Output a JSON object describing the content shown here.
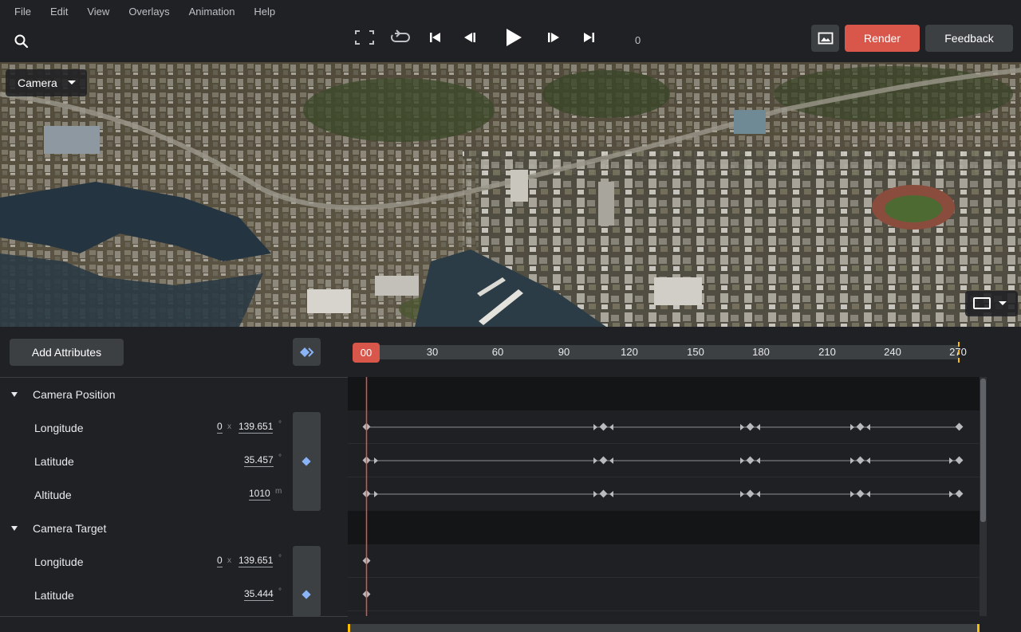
{
  "menu": [
    "File",
    "Edit",
    "View",
    "Overlays",
    "Animation",
    "Help"
  ],
  "toolbar": {
    "frame": "0",
    "render_label": "Render",
    "feedback_label": "Feedback"
  },
  "viewport": {
    "camera_select": "Camera"
  },
  "panel": {
    "add_attributes_label": "Add Attributes",
    "playhead_label": "00",
    "ruler_ticks": [
      "30",
      "60",
      "90",
      "120",
      "150",
      "180",
      "210",
      "240",
      "270"
    ],
    "groups": [
      {
        "name": "Camera Position",
        "attributes": [
          {
            "label": "Longitude",
            "prefix": "0",
            "sep": "x",
            "value": "139.651",
            "unit": "°"
          },
          {
            "label": "Latitude",
            "value": "35.457",
            "unit": "°"
          },
          {
            "label": "Altitude",
            "value": "1010",
            "unit": "m"
          }
        ]
      },
      {
        "name": "Camera Target",
        "attributes": [
          {
            "label": "Longitude",
            "prefix": "0",
            "sep": "x",
            "value": "139.651",
            "unit": "°"
          },
          {
            "label": "Latitude",
            "value": "35.444",
            "unit": "°"
          }
        ]
      }
    ]
  },
  "colors": {
    "accent": "#d9574a",
    "keyframe": "#8ab4f8",
    "end_marker": "#fbbc04",
    "background": "#202124"
  },
  "icons": [
    "search-icon",
    "fullscreen-icon",
    "loop-icon",
    "skip-start-icon",
    "step-back-icon",
    "play-icon",
    "step-forward-icon",
    "skip-end-icon",
    "image-icon",
    "keyframe-nav-icon"
  ]
}
